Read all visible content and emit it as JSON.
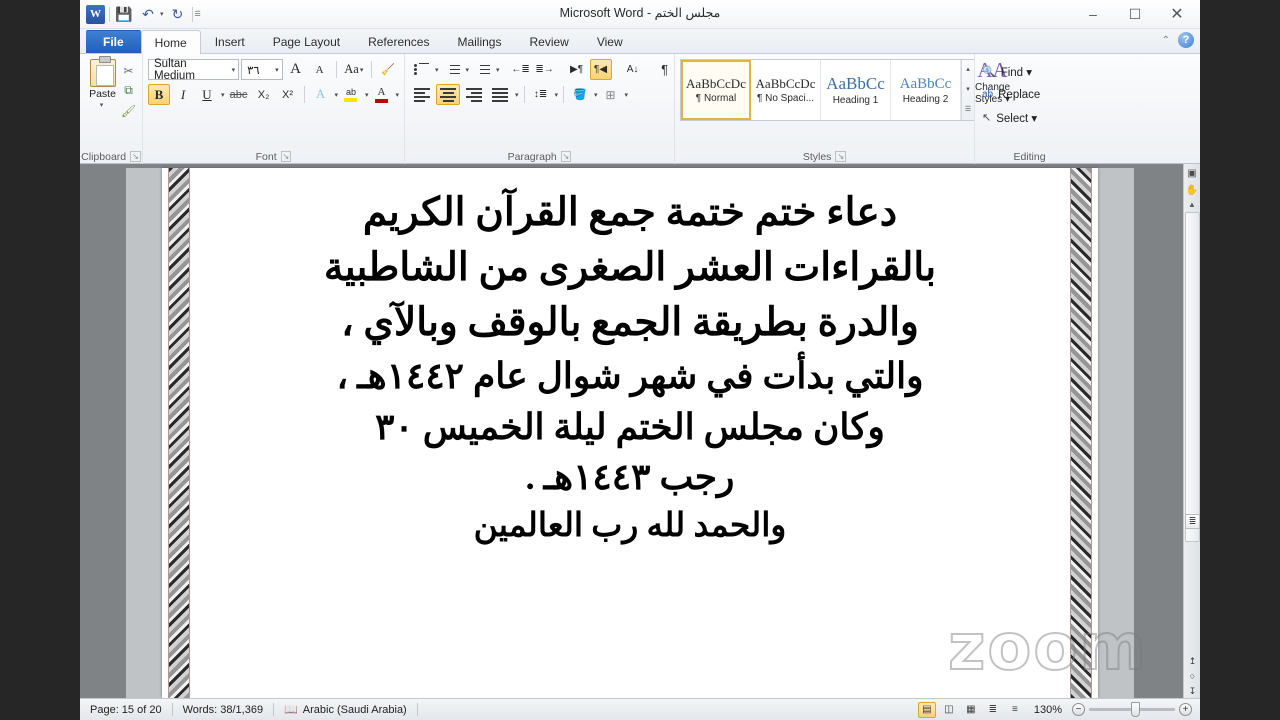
{
  "window": {
    "title": "مجلس الختم - Microsoft Word",
    "app_icon": "W",
    "minimize": "–",
    "maximize": "☐",
    "close": "✕"
  },
  "quick_access": {
    "save": "💾",
    "undo": "↶",
    "undo_caret": "▾",
    "redo": "↻",
    "customize": "☰"
  },
  "tabs": [
    {
      "label": "File",
      "active": false,
      "file": true
    },
    {
      "label": "Home",
      "active": true,
      "file": false
    },
    {
      "label": "Insert",
      "active": false,
      "file": false
    },
    {
      "label": "Page Layout",
      "active": false,
      "file": false
    },
    {
      "label": "References",
      "active": false,
      "file": false
    },
    {
      "label": "Mailings",
      "active": false,
      "file": false
    },
    {
      "label": "Review",
      "active": false,
      "file": false
    },
    {
      "label": "View",
      "active": false,
      "file": false
    }
  ],
  "ribbon_right": {
    "collapse": "⌃",
    "help": "?"
  },
  "ribbon": {
    "clipboard": {
      "label": "Clipboard",
      "paste_label": "Paste",
      "paste_caret": "▾",
      "cut": "✂",
      "copy": "⧉",
      "format_painter": "🖌",
      "dialog_launcher": "↘"
    },
    "font": {
      "label": "Font",
      "font_name": "Sultan Medium",
      "font_size": "٣٦",
      "combo_caret": "▾",
      "grow_font": "A",
      "shrink_font": "A",
      "change_case": "Aa",
      "clear_formatting": "🧹",
      "bold": "B",
      "italic": "I",
      "underline": "U",
      "strikethrough": "abc",
      "subscript": "X₂",
      "superscript": "X²",
      "text_effects": "A",
      "highlight": "ab",
      "font_color": "A",
      "dialog_launcher": "↘"
    },
    "paragraph": {
      "label": "Paragraph",
      "bullets": "•",
      "numbering": "1.",
      "multilevel": "≣",
      "decrease_indent": "←≣",
      "increase_indent": "≣→",
      "ltr_text": "▶¶",
      "rtl_text": "¶◀",
      "sort": "A↓",
      "show_marks": "¶",
      "align_left": "",
      "align_center": "",
      "align_right": "",
      "justify": "",
      "line_spacing": "↕≣",
      "shading": "🪣",
      "borders": "⊞",
      "dialog_launcher": "↘"
    },
    "styles": {
      "label": "Styles",
      "items": [
        {
          "preview": "AaBbCcDc",
          "name": "¶ Normal",
          "selected": true
        },
        {
          "preview": "AaBbCcDc",
          "name": "¶ No Spaci...",
          "selected": false
        },
        {
          "preview": "AaBbCс",
          "name": "Heading 1",
          "selected": false
        },
        {
          "preview": "AaBbCc",
          "name": "Heading 2",
          "selected": false
        }
      ],
      "scroll_up": "▴",
      "scroll_down": "▾",
      "more": "☰",
      "change_styles_label": "Change",
      "change_styles_label2": "Styles ▾",
      "change_styles_icon": "AA",
      "dialog_launcher": "↘"
    },
    "editing": {
      "label": "Editing",
      "find": "Find ▾",
      "find_icon": "🔍",
      "replace": "Replace",
      "replace_icon": "ab",
      "select": "Select ▾",
      "select_icon": "↖"
    }
  },
  "document": {
    "lines": [
      "دعاء ختم ختمة جمع القرآن الكريم",
      "بالقراءات العشر الصغرى من الشاطبية",
      "والدرة بطريقة الجمع بالوقف وبالآي ،",
      "والتي بدأت في شهر شوال عام ١٤٤٢هـ ،",
      "وكان مجلس الختم ليلة الخميس ٣٠",
      "رجب ١٤٤٣هـ .",
      "والحمد لله رب العالمين"
    ]
  },
  "scrollbar": {
    "ruler_icon": "▣",
    "hand_icon": "✋",
    "arrow_up": "▲",
    "select_object": "≣",
    "previous_page": "↥",
    "browse_object": "○",
    "next_page": "↧"
  },
  "statusbar": {
    "page": "Page: 15 of 20",
    "words": "Words: 38/1,369",
    "proofing_icon": "📖",
    "language": "Arabic (Saudi Arabia)",
    "views": [
      {
        "name": "print-layout",
        "glyph": "▤",
        "active": true
      },
      {
        "name": "full-screen-reading",
        "glyph": "◫",
        "active": false
      },
      {
        "name": "web-layout",
        "glyph": "▦",
        "active": false
      },
      {
        "name": "outline",
        "glyph": "≣",
        "active": false
      },
      {
        "name": "draft",
        "glyph": "≡",
        "active": false
      }
    ],
    "zoom_value": "130%",
    "zoom_out": "−",
    "zoom_in": "+"
  },
  "watermark": {
    "text": "zoom"
  },
  "colors": {
    "file_tab": "#1f5fb8",
    "accent_gold": "#f7d277",
    "ribbon_bg": "#eef1f5",
    "doc_bg": "#7f8386",
    "page": "#ffffff"
  }
}
